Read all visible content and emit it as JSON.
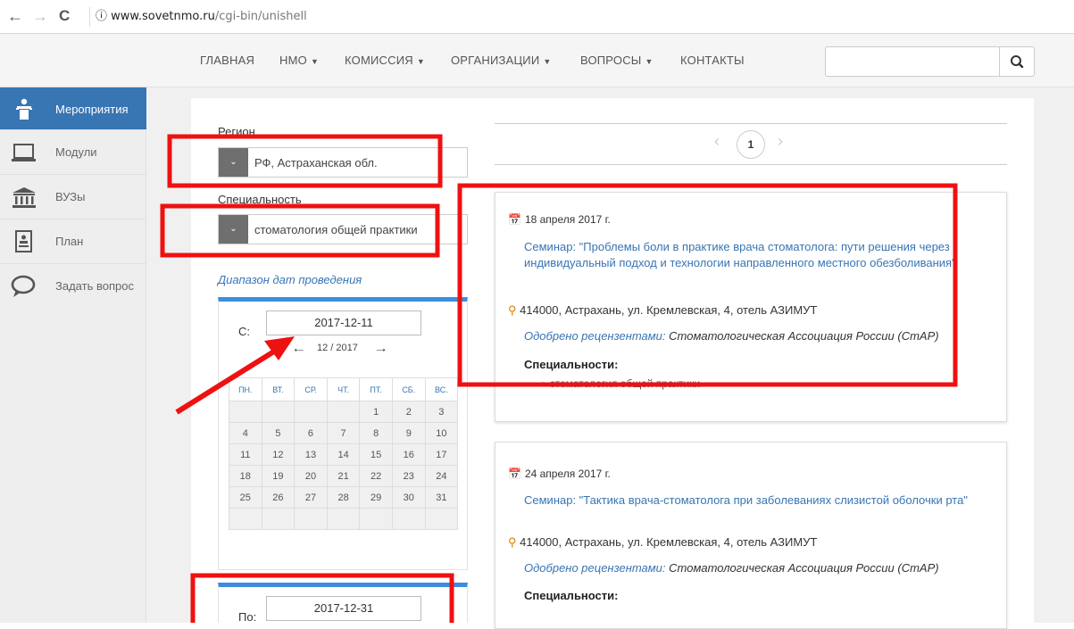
{
  "browser": {
    "back": "←",
    "forward": "→",
    "reload": "C",
    "info": "ⓘ",
    "url_host": "www.sovetnmo.ru",
    "url_path": "/cgi-bin/unishell"
  },
  "topnav": {
    "items": [
      {
        "label": "ГЛАВНАЯ",
        "caret": ""
      },
      {
        "label": "НМО",
        "caret": "▼"
      },
      {
        "label": "КОМИССИЯ",
        "caret": "▼"
      },
      {
        "label": "ОРГАНИЗАЦИИ",
        "caret": "▼"
      },
      {
        "label": "ВОПРОСЫ",
        "caret": "▼"
      },
      {
        "label": "КОНТАКТЫ",
        "caret": ""
      }
    ],
    "search_value": "",
    "search_icon": "magnifier-icon"
  },
  "sidebar": {
    "items": [
      {
        "label": "Мероприятия",
        "icon": "podium-icon",
        "active": true
      },
      {
        "label": "Модули",
        "icon": "laptop-icon",
        "active": false
      },
      {
        "label": "ВУЗы",
        "icon": "university-icon",
        "active": false
      },
      {
        "label": "План",
        "icon": "plan-icon",
        "active": false
      },
      {
        "label": "Задать вопрос",
        "icon": "chat-icon",
        "active": false
      }
    ]
  },
  "filters": {
    "region_label": "Регион",
    "region_value": "РФ, Астраханская обл.",
    "specialty_label": "Специальность",
    "specialty_value": "стоматология общей практики",
    "date_range_label": "Диапазон дат проведения",
    "from_label": "С:",
    "from_value": "2017-12-11",
    "to_label": "По:",
    "to_value": "2017-12-31",
    "month_label": "12 / 2017",
    "weekdays": [
      "пн.",
      "вт.",
      "ср.",
      "чт.",
      "пт.",
      "сб.",
      "вс."
    ],
    "weeks": [
      [
        "",
        "",
        "",
        "",
        "1",
        "2",
        "3"
      ],
      [
        "4",
        "5",
        "6",
        "7",
        "8",
        "9",
        "10"
      ],
      [
        "11",
        "12",
        "13",
        "14",
        "15",
        "16",
        "17"
      ],
      [
        "18",
        "19",
        "20",
        "21",
        "22",
        "23",
        "24"
      ],
      [
        "25",
        "26",
        "27",
        "28",
        "29",
        "30",
        "31"
      ],
      [
        "",
        "",
        "",
        "",
        "",
        "",
        ""
      ]
    ]
  },
  "pager": {
    "prev": "‹",
    "current": "1",
    "next": "›"
  },
  "events": [
    {
      "date": "18 апреля 2017 г.",
      "title": "Семинар: \"Проблемы боли в практике врача стоматолога: пути решения через индивидуальный подход и технологии направленного местного обезболивания\"",
      "address": "414000, Астрахань, ул. Кремлевская, 4, отель АЗИМУТ",
      "approved_label": "Одобрено рецензентами:",
      "approved_by": "Стоматологическая Ассоциация России (СтАР)",
      "spec_header": "Специальности:",
      "spec_item": "стоматология общей практики"
    },
    {
      "date": "24 апреля 2017 г.",
      "title": "Семинар: \"Тактика врача-стоматолога при заболеваниях слизистой оболочки рта\"",
      "address": "414000, Астрахань, ул. Кремлевская, 4, отель АЗИМУТ",
      "approved_label": "Одобрено рецензентами:",
      "approved_by": "Стоматологическая Ассоциация России (СтАР)",
      "spec_header": "Специальности:"
    }
  ],
  "annotation_color": "#ee1111"
}
